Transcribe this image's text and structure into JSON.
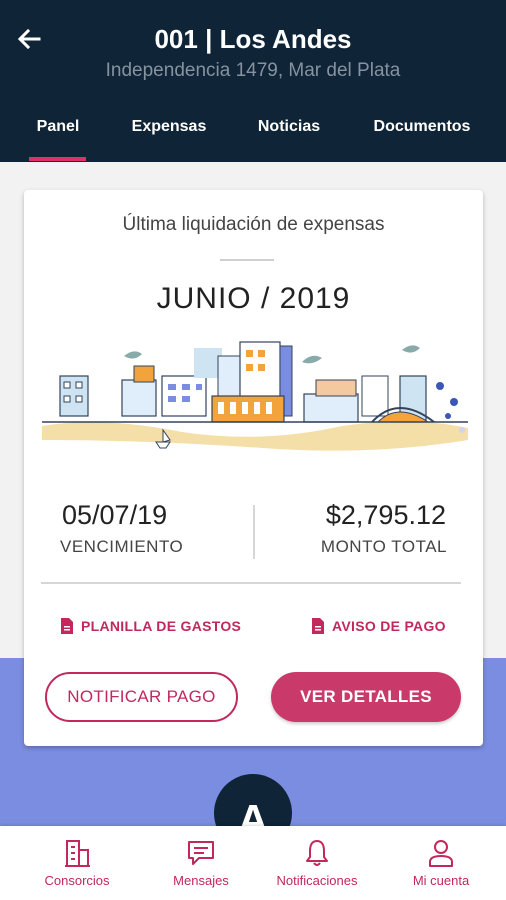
{
  "header": {
    "title": "001 | Los Andes",
    "subtitle": "Independencia 1479,  Mar del Plata",
    "tabs": [
      {
        "label": "Panel",
        "active": true
      },
      {
        "label": "Expensas",
        "active": false
      },
      {
        "label": "Noticias",
        "active": false
      },
      {
        "label": "Documentos",
        "active": false
      }
    ]
  },
  "card": {
    "title": "Última liquidación de expensas",
    "period": "JUNIO / 2019",
    "due_date": "05/07/19",
    "due_label": "VENCIMIENTO",
    "amount": "$2,795.12",
    "amount_label": "MONTO TOTAL",
    "links": {
      "expenses_sheet": "PLANILLA DE GASTOS",
      "payment_notice": "AVISO DE PAGO"
    },
    "buttons": {
      "notify": "NOTIFICAR PAGO",
      "details": "VER DETALLES"
    }
  },
  "logo_letter": "A",
  "bottom_nav": [
    {
      "label": "Consorcios",
      "icon": "building-icon"
    },
    {
      "label": "Mensajes",
      "icon": "message-icon"
    },
    {
      "label": "Notificaciones",
      "icon": "bell-icon"
    },
    {
      "label": "Mi cuenta",
      "icon": "user-icon"
    }
  ],
  "colors": {
    "header_bg": "#0f2437",
    "accent": "#c2285c",
    "accent_fill": "#c93a6a",
    "background_band": "#7b8de0"
  }
}
